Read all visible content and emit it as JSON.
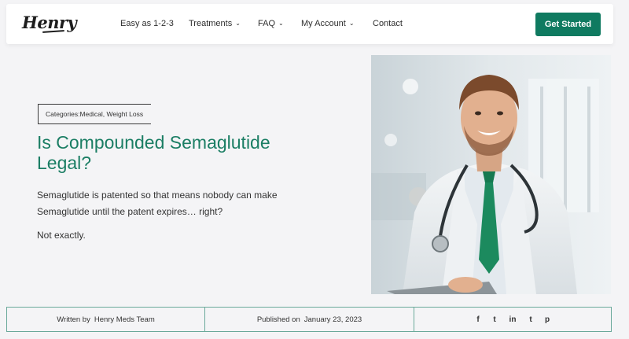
{
  "header": {
    "logo": "Henry",
    "nav": [
      {
        "label": "Easy as 1-2-3",
        "dropdown": false
      },
      {
        "label": "Treatments",
        "dropdown": true
      },
      {
        "label": "FAQ",
        "dropdown": true
      },
      {
        "label": "My Account",
        "dropdown": true
      },
      {
        "label": "Contact",
        "dropdown": false
      }
    ],
    "cta_label": "Get Started"
  },
  "article": {
    "categories_prefix": "Categories: ",
    "categories": "Medical, Weight Loss",
    "title": "Is Compounded Semaglutide Legal?",
    "intro": "Semaglutide is patented so that means nobody can make Semaglutide until the patent expires… right?",
    "intro2": "Not exactly.",
    "author_label": "Written by",
    "author": "Henry Meds Team",
    "published_label": "Published on",
    "published_date": "January 23, 2023"
  },
  "social": {
    "facebook": "f",
    "twitter": "t",
    "linkedin": "in",
    "tumblr": "t",
    "pinterest": "p"
  },
  "colors": {
    "brand_green": "#0f7a60",
    "title_green": "#1b7e64",
    "background": "#f4f4f6"
  },
  "photo": {
    "icon": "doctor-photo"
  }
}
